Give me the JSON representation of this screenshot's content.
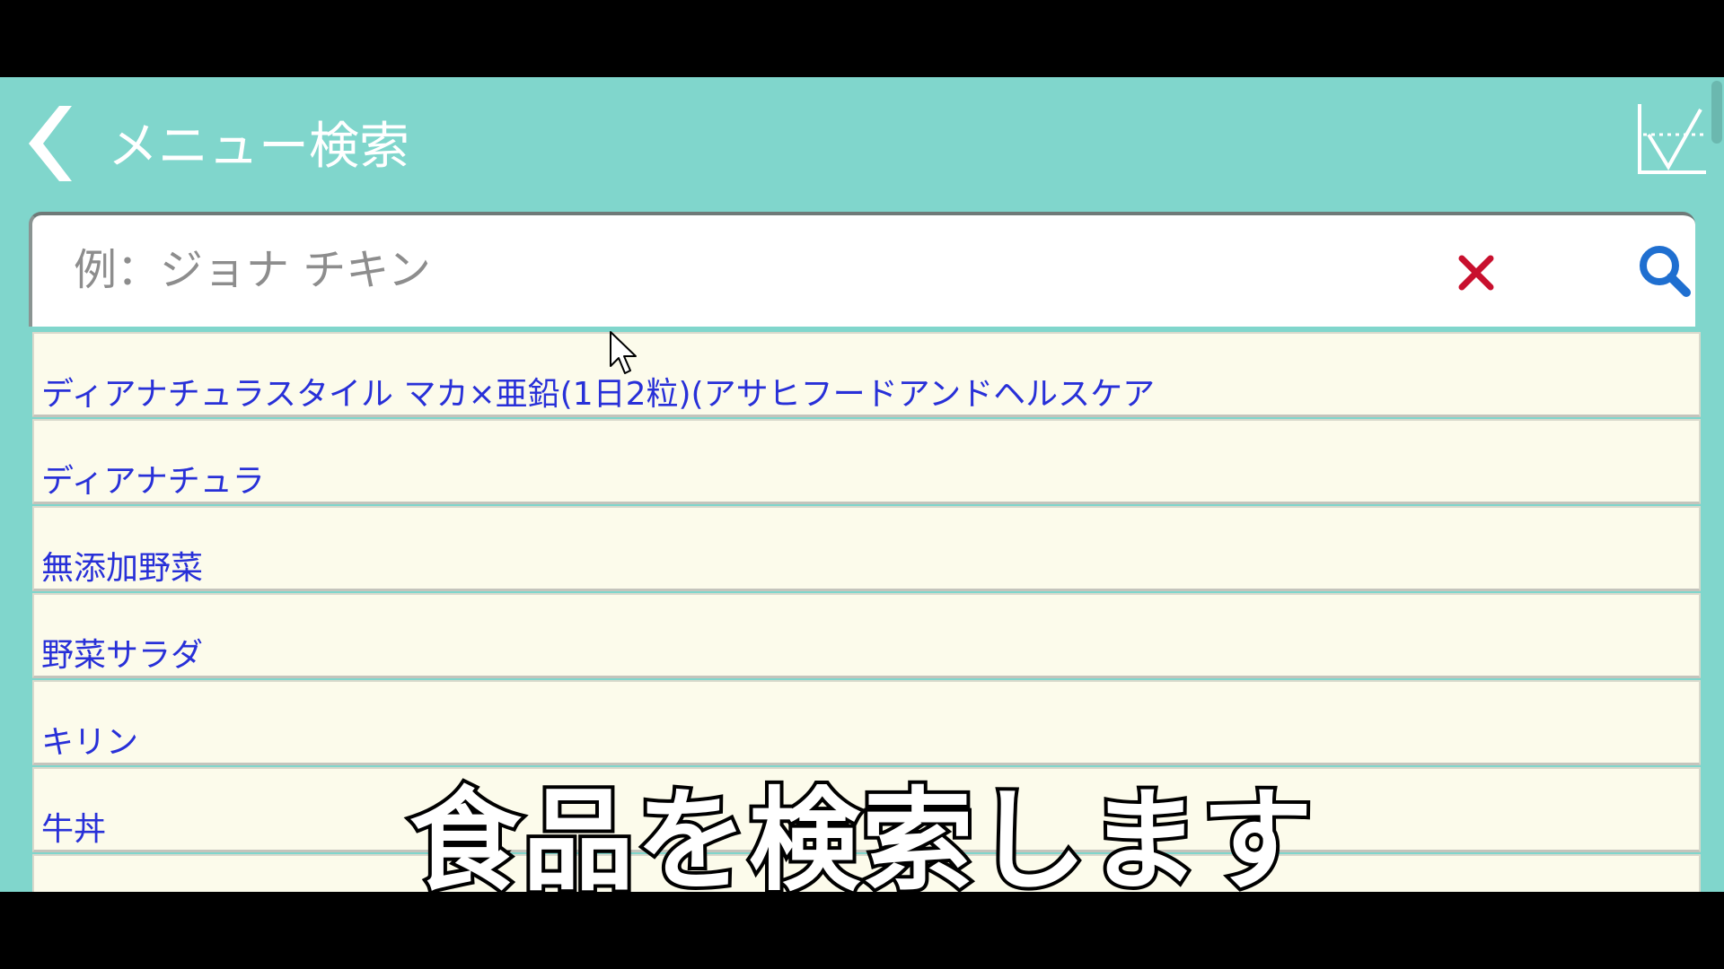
{
  "header": {
    "title": "メニュー検索",
    "back_icon": "chevron-left-icon",
    "chart_icon": "chart-icon"
  },
  "search": {
    "placeholder": "例：ジョナ チキン",
    "value": "",
    "clear_icon": "close-icon",
    "search_icon": "search-icon"
  },
  "results": [
    {
      "label": "ディアナチュラスタイル マカ×亜鉛(1日2粒)(アサヒフードアンドヘルスケア"
    },
    {
      "label": "ディアナチュラ"
    },
    {
      "label": "無添加野菜"
    },
    {
      "label": "野菜サラダ"
    },
    {
      "label": "キリン"
    },
    {
      "label": "牛丼"
    },
    {
      "label": ""
    }
  ],
  "subtitle": "食品を検索します",
  "colors": {
    "header_bg": "#80d6cc",
    "result_bg": "#fcfbeb",
    "result_text": "#2830d8",
    "clear_icon": "#c8102e",
    "search_icon": "#1f6fd0"
  }
}
